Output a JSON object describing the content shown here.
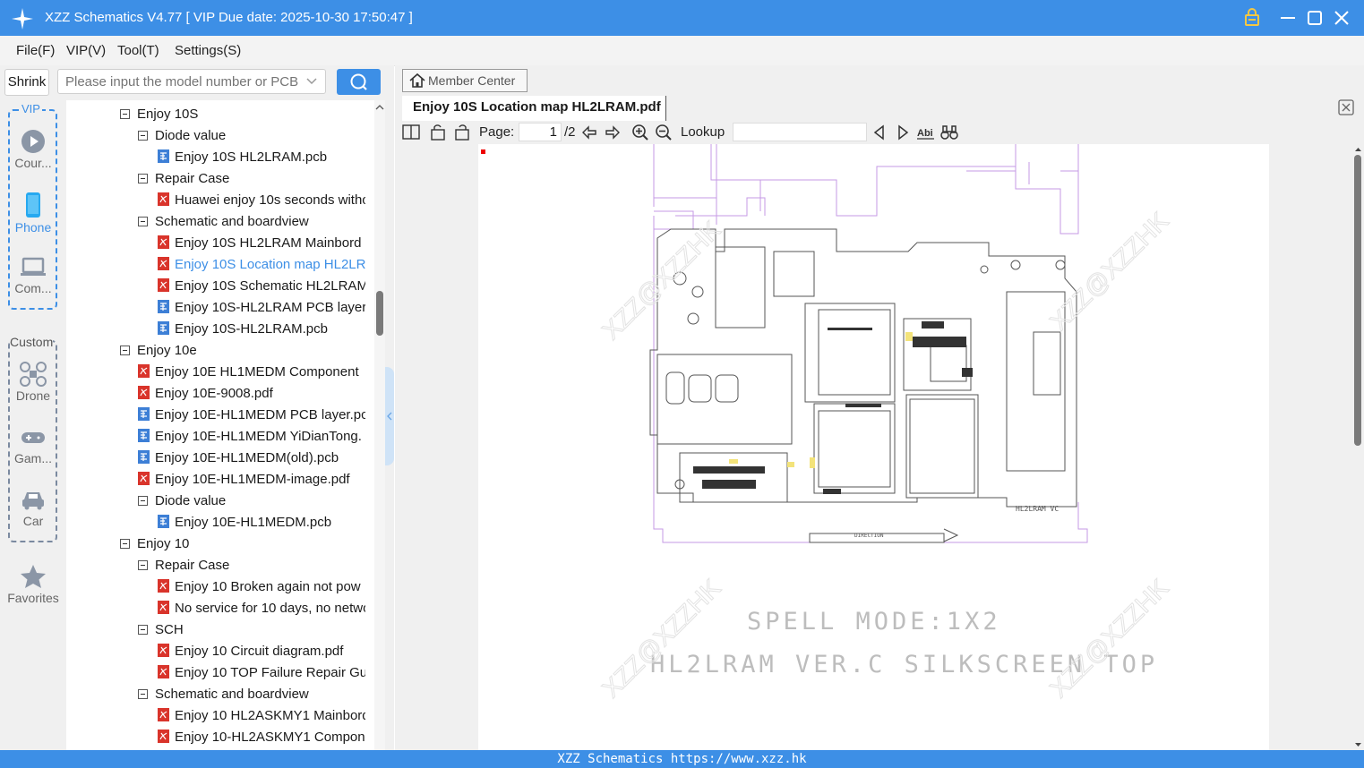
{
  "window": {
    "title": "XZZ Schematics V4.77 [ VIP Due date: 2025-10-30 17:50:47 ]"
  },
  "menu": [
    "File(F)",
    "VIP(V)",
    "Tool(T)",
    "Settings(S)"
  ],
  "search": {
    "shrink_label": "Shrink",
    "placeholder": "Please input the model number or PCB"
  },
  "sidebar": {
    "vip_label": "VIP",
    "custom_label": "Custom",
    "items": [
      {
        "label": "Cour...",
        "icon": "play-circle-icon"
      },
      {
        "label": "Phone",
        "icon": "phone-icon",
        "active": true
      },
      {
        "label": "Com...",
        "icon": "laptop-icon"
      },
      {
        "label": "Drone",
        "icon": "drone-icon"
      },
      {
        "label": "Gam...",
        "icon": "gamepad-icon"
      },
      {
        "label": "Car",
        "icon": "car-icon"
      },
      {
        "label": "Favorites",
        "icon": "star-icon"
      }
    ]
  },
  "tree": [
    {
      "label": "Enjoy 10S",
      "level": 0,
      "type": "folder"
    },
    {
      "label": "Diode value",
      "level": 1,
      "type": "folder"
    },
    {
      "label": "Enjoy 10S HL2LRAM.pcb",
      "level": 2,
      "type": "pcb"
    },
    {
      "label": "Repair Case",
      "level": 1,
      "type": "folder"
    },
    {
      "label": "Huawei enjoy 10s seconds witho",
      "level": 2,
      "type": "pdf"
    },
    {
      "label": "Schematic and boardview",
      "level": 1,
      "type": "folder"
    },
    {
      "label": "Enjoy 10S HL2LRAM Mainbord",
      "level": 2,
      "type": "pdf"
    },
    {
      "label": "Enjoy 10S Location map HL2LRA",
      "level": 2,
      "type": "pdf",
      "selected": true
    },
    {
      "label": "Enjoy 10S Schematic HL2LRAM.",
      "level": 2,
      "type": "pdf"
    },
    {
      "label": "Enjoy 10S-HL2LRAM PCB layer.p",
      "level": 2,
      "type": "pcb"
    },
    {
      "label": "Enjoy 10S-HL2LRAM.pcb",
      "level": 2,
      "type": "pcb"
    },
    {
      "label": "Enjoy 10e",
      "level": 0,
      "type": "folder"
    },
    {
      "label": "Enjoy 10E HL1MEDM Component",
      "level": 1,
      "type": "pdf"
    },
    {
      "label": "Enjoy 10E-9008.pdf",
      "level": 1,
      "type": "pdf"
    },
    {
      "label": "Enjoy 10E-HL1MEDM PCB layer.pc",
      "level": 1,
      "type": "pcb"
    },
    {
      "label": "Enjoy 10E-HL1MEDM YiDianTong.",
      "level": 1,
      "type": "pcb"
    },
    {
      "label": "Enjoy 10E-HL1MEDM(old).pcb",
      "level": 1,
      "type": "pcb"
    },
    {
      "label": "Enjoy 10E-HL1MEDM-image.pdf",
      "level": 1,
      "type": "pdf"
    },
    {
      "label": "Diode value",
      "level": 1,
      "type": "folder"
    },
    {
      "label": "Enjoy 10E-HL1MEDM.pcb",
      "level": 2,
      "type": "pcb"
    },
    {
      "label": "Enjoy 10",
      "level": 0,
      "type": "folder"
    },
    {
      "label": "Repair Case",
      "level": 1,
      "type": "folder"
    },
    {
      "label": "Enjoy 10 Broken again not pow",
      "level": 2,
      "type": "pdf"
    },
    {
      "label": "No service for 10 days, no netwo",
      "level": 2,
      "type": "pdf"
    },
    {
      "label": "SCH",
      "level": 1,
      "type": "folder"
    },
    {
      "label": "Enjoy 10 Circuit diagram.pdf",
      "level": 2,
      "type": "pdf"
    },
    {
      "label": "Enjoy 10 TOP Failure Repair Gui",
      "level": 2,
      "type": "pdf"
    },
    {
      "label": "Schematic and boardview",
      "level": 1,
      "type": "folder"
    },
    {
      "label": "Enjoy 10 HL2ASKMY1 Mainbord",
      "level": 2,
      "type": "pdf"
    },
    {
      "label": "Enjoy 10-HL2ASKMY1 Compone",
      "level": 2,
      "type": "pdf"
    }
  ],
  "viewer": {
    "member_center": "Member Center",
    "tab_title": "Enjoy 10S Location map HL2LRAM.pdf",
    "page_label": "Page:",
    "page_current": "1",
    "page_total": "/2",
    "lookup_label": "Lookup",
    "doc_text_1": "SPELL MODE:1X2",
    "doc_text_2": "HL2LRAM VER.C SILKSCREEN TOP",
    "board_label": "HL2LRAM VC",
    "direction_label": "DIRECTION",
    "watermark": "XZZ@XZZHK"
  },
  "status": {
    "text": "XZZ Schematics https://www.xzz.hk"
  },
  "colors": {
    "accent": "#3d8fe6",
    "pdf_icon": "#d9342b",
    "pcb_icon": "#3d7fd6",
    "selected_text": "#3d8fe6"
  }
}
